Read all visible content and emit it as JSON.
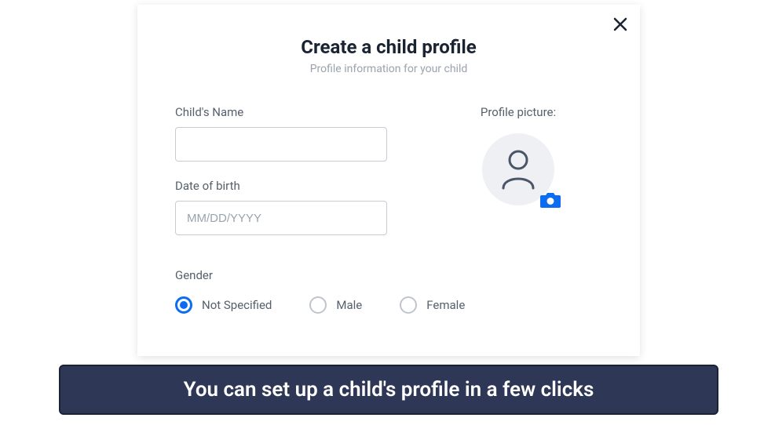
{
  "modal": {
    "title": "Create a child profile",
    "subtitle": "Profile information for your child",
    "name_label": "Child's Name",
    "name_value": "",
    "dob_label": "Date of birth",
    "dob_placeholder": "MM/DD/YYYY",
    "dob_value": "",
    "picture_label": "Profile picture:",
    "gender_label": "Gender",
    "gender_options": {
      "not_specified": "Not Specified",
      "male": "Male",
      "female": "Female"
    },
    "gender_selected": "not_specified"
  },
  "caption": "You can set up a child's profile in a few clicks",
  "icons": {
    "close": "close-icon",
    "avatar": "person-icon",
    "camera": "camera-icon"
  },
  "colors": {
    "accent": "#0c6cf2",
    "caption_bg": "#2e3756",
    "text_dark": "#1a2332",
    "text_muted": "#9ba3ad"
  }
}
